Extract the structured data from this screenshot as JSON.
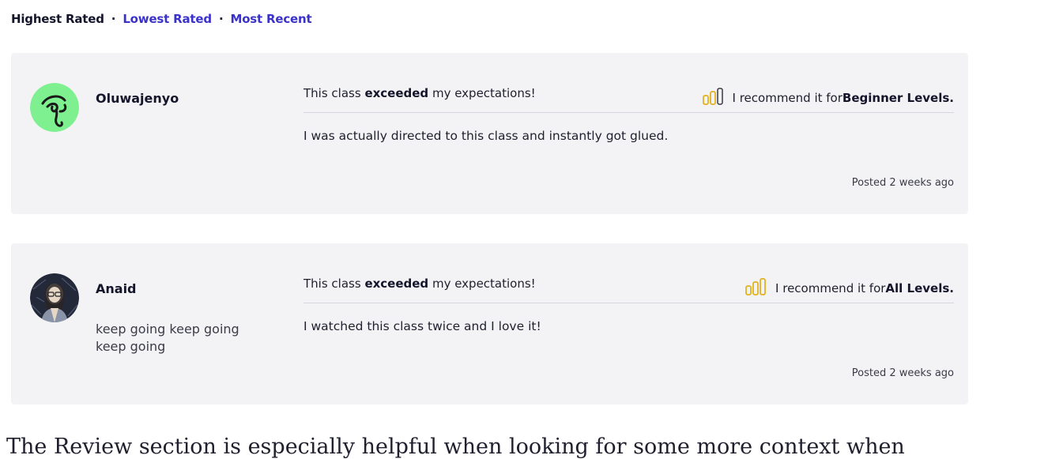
{
  "sort": {
    "highest": "Highest Rated",
    "separator": "·",
    "lowest": "Lowest Rated",
    "recent": "Most Recent"
  },
  "reviews": [
    {
      "name": "Oluwajenyo",
      "bio": "",
      "avatar_icon": "green-line-art-face-avatar",
      "headline_pre": "This class ",
      "headline_bold": "exceeded",
      "headline_post": " my expectations!",
      "level_icon": "level-bars-icon",
      "recommend_pre": "I recommend it for ",
      "recommend_level": "Beginner Levels.",
      "text": "I was actually directed to this class and instantly got glued.",
      "posted": "Posted 2 weeks ago"
    },
    {
      "name": "Anaid",
      "bio": "keep going keep going keep going",
      "avatar_icon": "dark-illustrated-portrait-avatar",
      "headline_pre": "This class ",
      "headline_bold": "exceeded",
      "headline_post": " my expectations!",
      "level_icon": "level-bars-icon",
      "recommend_pre": "I recommend it for ",
      "recommend_level": "All Levels.",
      "text": "I watched this class twice and I love it!",
      "posted": "Posted 2 weeks ago"
    }
  ],
  "footer_partial": "The Review section is especially helpful when looking for some more context when",
  "colors": {
    "link": "#3a32c9",
    "card_bg": "#f3f3f6",
    "level_icon": "#e0b21e",
    "avatar_green": "#7ef08f"
  }
}
